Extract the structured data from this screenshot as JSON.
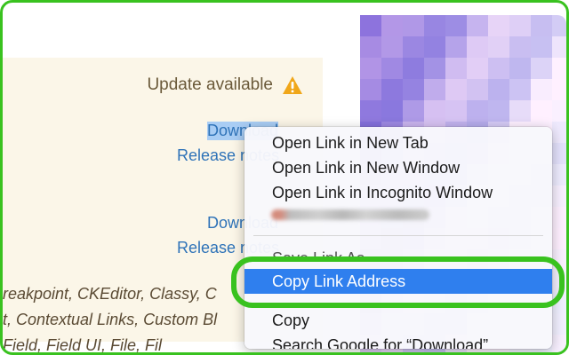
{
  "update": {
    "status_text": "Update available",
    "icon": "warning-icon",
    "icon_color": "#f0a71a"
  },
  "links": {
    "download_1": "Download",
    "release_1": "Release notes",
    "download_2": "Download",
    "release_2": "Release notes"
  },
  "modules": {
    "line_1": "reakpoint, CKEditor, Classy, C",
    "line_2": "t, Contextual Links, Custom Bl",
    "line_3": "                   Field, Field UI, File, Fil"
  },
  "context_menu": {
    "items": [
      {
        "label": "Open Link in New Tab"
      },
      {
        "label": "Open Link in New Window"
      },
      {
        "label": "Open Link in Incognito Window"
      },
      {
        "label": "Save Link As..."
      },
      {
        "label": "Copy Link Address"
      },
      {
        "label": "Copy"
      },
      {
        "label": "Search Google for “Download”"
      }
    ],
    "selected": "Copy Link Address"
  },
  "colors": {
    "highlight_ring": "#39c21f",
    "menu_selection": "#2f7fee",
    "link": "#2f73b8"
  }
}
